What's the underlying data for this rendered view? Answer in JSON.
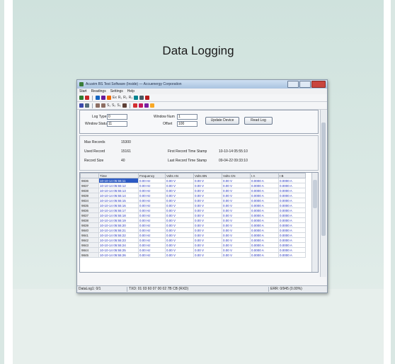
{
  "page": {
    "heading": "Data Logging"
  },
  "window": {
    "title": "Acuvim BS Test Software (Inside) — Accuenergy Corporation",
    "menu": [
      "Start",
      "Readings",
      "Settings",
      "Help"
    ],
    "toolbar1": [
      "Ex",
      "R₁",
      "R₂",
      "R₃"
    ],
    "toolbar2": [
      "S₁",
      "S₂",
      "S₃"
    ]
  },
  "form": {
    "log_type_label": "Log Type",
    "log_type_value": "0",
    "window_status_label": "Window Status",
    "window_status_value": "11",
    "window_num_label": "Window Num",
    "window_num_value": "1",
    "offset_label": "Offset",
    "offset_value": "100",
    "update_button": "Update Device",
    "read_button": "Read Log"
  },
  "info": {
    "max_records_label": "Max Records",
    "max_records_value": "15300",
    "used_record_label": "Used Record",
    "used_record_value": "15161",
    "record_size_label": "Record Size",
    "record_size_value": "40",
    "first_stamp_label": "First Record Time Stamp",
    "first_stamp_value": "10-10-14 05:55:10",
    "last_stamp_label": "Last Record Time Stamp",
    "last_stamp_value": "09-04-22 09:33:10"
  },
  "grid": {
    "headers": [
      "",
      "Time",
      "Frequency",
      "Volts AN",
      "Volts BN",
      "Volts CN",
      "I A",
      "I B"
    ],
    "rows": [
      [
        "9836",
        "10-10-14 05:55:11",
        "0.00 Hz",
        "0.00 V",
        "0.00 V",
        "0.00 V",
        "0.0000 A",
        "0.0000 A"
      ],
      [
        "9837",
        "10-10-14 05:55:12",
        "0.00 Hz",
        "0.00 V",
        "0.00 V",
        "0.00 V",
        "0.0000 A",
        "0.0000 A"
      ],
      [
        "9838",
        "10-10-14 05:55:13",
        "0.00 Hz",
        "0.00 V",
        "0.00 V",
        "0.00 V",
        "0.0000 A",
        "0.0000 A"
      ],
      [
        "9839",
        "10-10-14 05:55:14",
        "0.00 Hz",
        "0.00 V",
        "0.00 V",
        "0.00 V",
        "0.0000 A",
        "0.0000 A"
      ],
      [
        "9834",
        "10-10-14 05:55:15",
        "0.00 Hz",
        "0.00 V",
        "0.00 V",
        "0.00 V",
        "0.0000 A",
        "0.0000 A"
      ],
      [
        "9835",
        "10-10-14 05:55:16",
        "0.00 Hz",
        "0.00 V",
        "0.00 V",
        "0.00 V",
        "0.0000 A",
        "0.0000 A"
      ],
      [
        "9836",
        "10-10-14 05:55:17",
        "0.00 Hz",
        "0.00 V",
        "0.00 V",
        "0.00 V",
        "0.0000 A",
        "0.0000 A"
      ],
      [
        "9837",
        "10-10-14 05:55:18",
        "0.00 Hz",
        "0.00 V",
        "0.00 V",
        "0.00 V",
        "0.0000 A",
        "0.0000 A"
      ],
      [
        "9838",
        "10-10-14 05:55:19",
        "0.00 Hz",
        "0.00 V",
        "0.00 V",
        "0.00 V",
        "0.0000 A",
        "0.0000 A"
      ],
      [
        "9839",
        "10-10-14 05:55:20",
        "0.00 Hz",
        "0.00 V",
        "0.00 V",
        "0.00 V",
        "0.0000 A",
        "0.0000 A"
      ],
      [
        "9840",
        "10-10-14 05:55:21",
        "0.00 Hz",
        "0.00 V",
        "0.00 V",
        "0.00 V",
        "0.0000 A",
        "0.0000 A"
      ],
      [
        "9841",
        "10-10-14 05:55:22",
        "0.00 Hz",
        "0.00 V",
        "0.00 V",
        "0.00 V",
        "0.0000 A",
        "0.0000 A"
      ],
      [
        "9842",
        "10-10-14 05:55:23",
        "0.00 Hz",
        "0.00 V",
        "0.00 V",
        "0.00 V",
        "0.0000 A",
        "0.0000 A"
      ],
      [
        "9843",
        "10-10-14 05:55:24",
        "0.00 Hz",
        "0.00 V",
        "0.00 V",
        "0.00 V",
        "0.0000 A",
        "0.0000 A"
      ],
      [
        "9844",
        "10-10-14 05:55:25",
        "0.00 Hz",
        "0.00 V",
        "0.00 V",
        "0.00 V",
        "0.0000 A",
        "0.0000 A"
      ],
      [
        "9845",
        "10-10-14 05:55:26",
        "0.00 Hz",
        "0.00 V",
        "0.00 V",
        "0.00 V",
        "0.0000 A",
        "0.0000 A"
      ]
    ]
  },
  "status": {
    "left": "DataLog1: 0/1",
    "middle": "TXD: 01 03 60 07 00 02 7B CB (RXD)",
    "right": "ERR: 0/945 (0.00%)"
  },
  "colors": {
    "selection": "#2b59c3",
    "value_text": "#1f2fbf",
    "title_gradient_top": "#cfe0f2"
  }
}
